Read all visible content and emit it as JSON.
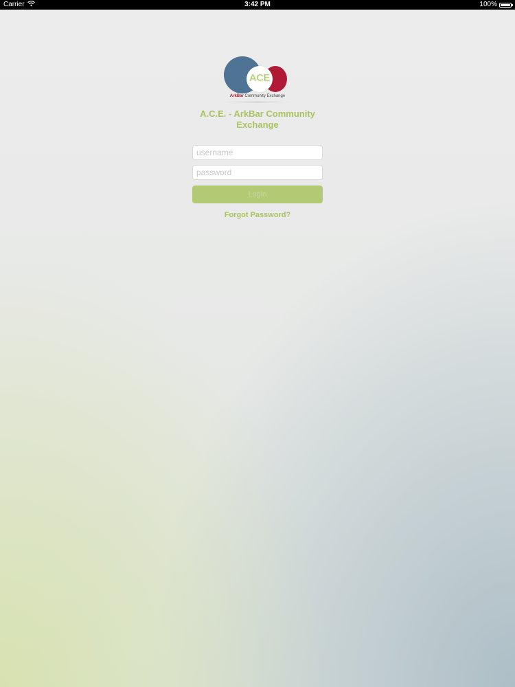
{
  "status_bar": {
    "carrier": "Carrier",
    "time": "3:42 PM",
    "battery": "100%",
    "battery_level": 1.0
  },
  "logo": {
    "ace": "ACE",
    "sub_ark": "ArkBar",
    "sub_rest": " Community Exchange"
  },
  "app_title": "A.C.E. - ArkBar Community Exchange",
  "login_form": {
    "username_placeholder": "username",
    "username_value": "",
    "password_placeholder": "password",
    "password_value": "",
    "login_label": "Login",
    "forgot_password": "Forgot Password?"
  },
  "colors": {
    "accent_green": "#a9c45e",
    "logo_blue": "#4e7394",
    "logo_red": "#b11a35"
  },
  "icons": [
    "wifi-icon",
    "battery-icon"
  ]
}
